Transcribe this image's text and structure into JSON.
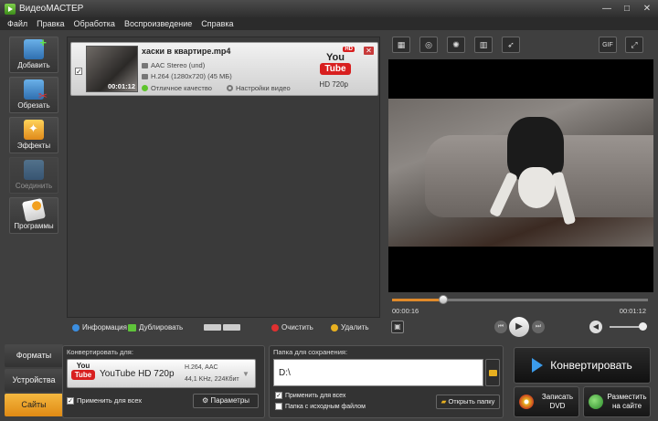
{
  "title": "ВидеоМАСТЕР",
  "window_controls": [
    "—",
    "□",
    "✕"
  ],
  "menu": [
    "Файл",
    "Правка",
    "Обработка",
    "Воспроизведение",
    "Справка"
  ],
  "sidebar": [
    {
      "label": "Добавить",
      "icon": "add-video-icon",
      "enabled": true
    },
    {
      "label": "Обрезать",
      "icon": "cut-icon",
      "enabled": true
    },
    {
      "label": "Эффекты",
      "icon": "effects-icon",
      "enabled": true
    },
    {
      "label": "Соединить",
      "icon": "join-icon",
      "enabled": false
    },
    {
      "label": "Программы",
      "icon": "programs-icon",
      "enabled": true
    }
  ],
  "file": {
    "name": "хаски в квартире.mp4",
    "audio": "AAC Stereo (und)",
    "video": "H.264 (1280x720) (45 МБ)",
    "quality": "Отличное качество",
    "settings": "Настройки видео",
    "duration": "00:01:12",
    "format_caption": "HD 720p",
    "checked": true
  },
  "youtube_logo": {
    "you": "You",
    "tube": "Tube",
    "hd": "HD"
  },
  "list_toolbar": {
    "info": "Информация",
    "duplicate": "Дублировать",
    "clear": "Очистить",
    "delete": "Удалить"
  },
  "preview_tools": [
    "crop-icon",
    "stabilize-icon",
    "brightness-icon",
    "filmstrip-icon",
    "speed-icon",
    "gif-icon",
    "fullscreen-icon"
  ],
  "preview_tool_glyphs": [
    "▦",
    "◎",
    "✺",
    "▥",
    "➶",
    "GIF",
    "⤢"
  ],
  "playback": {
    "current": "00:00:16",
    "total": "00:01:12",
    "progress": 0.2,
    "volume": 0.9
  },
  "tabs": [
    {
      "label": "Форматы",
      "active": false
    },
    {
      "label": "Устройства",
      "active": false
    },
    {
      "label": "Сайты",
      "active": true
    }
  ],
  "convert": {
    "label": "Конвертировать для:",
    "format": "YouTube HD 720p",
    "codec": "H.264, AAC",
    "audio": "44,1 KHz, 224Кбит",
    "apply_all": "Применить для всех",
    "params": "Параметры"
  },
  "save": {
    "label": "Папка для сохранения:",
    "path": "D:\\",
    "apply_all": "Применить для всех",
    "source_folder": "Папка с исходным файлом",
    "open_folder": "Открыть папку"
  },
  "actions": {
    "convert": "Конвертировать",
    "dvd_line1": "Записать",
    "dvd_line2": "DVD",
    "site_line1": "Разместить",
    "site_line2": "на сайте"
  },
  "colors": {
    "accent": "#e08a14",
    "convert_arrow": "#3b9bea",
    "youtube_red": "#d81f1f"
  }
}
